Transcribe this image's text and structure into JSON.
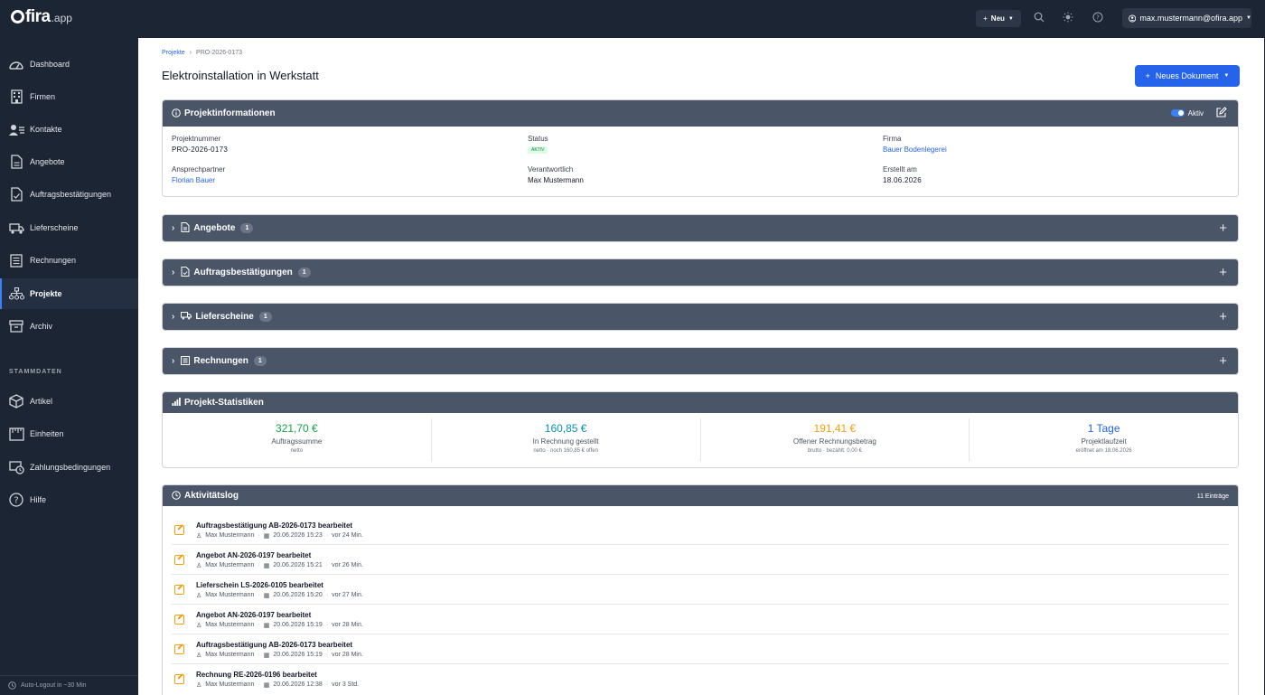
{
  "topbar": {
    "logo_name": "fira",
    "logo_tld": ".app",
    "new_label": "Neu",
    "user_email": "max.mustermann@ofira.app"
  },
  "sidebar": {
    "items": [
      {
        "label": "Dashboard",
        "icon": "dashboard-icon"
      },
      {
        "label": "Firmen",
        "icon": "building-icon"
      },
      {
        "label": "Kontakte",
        "icon": "contacts-icon"
      },
      {
        "label": "Angebote",
        "icon": "document-icon"
      },
      {
        "label": "Auftragsbestätigungen",
        "icon": "document-check-icon"
      },
      {
        "label": "Lieferscheine",
        "icon": "truck-icon"
      },
      {
        "label": "Rechnungen",
        "icon": "invoice-icon"
      },
      {
        "label": "Projekte",
        "icon": "project-tree-icon",
        "active": true
      },
      {
        "label": "Archiv",
        "icon": "archive-icon"
      }
    ],
    "section_title": "STAMMDATEN",
    "master_items": [
      {
        "label": "Artikel",
        "icon": "box-icon"
      },
      {
        "label": "Einheiten",
        "icon": "ruler-icon"
      },
      {
        "label": "Zahlungsbedingungen",
        "icon": "payment-icon"
      },
      {
        "label": "Hilfe",
        "icon": "help-icon"
      }
    ],
    "footer_text": "Auto-Logout in ~30 Min"
  },
  "breadcrumb": {
    "root": "Projekte",
    "current": "PRO-2026-0173"
  },
  "page": {
    "title": "Elektroinstallation in Werkstatt",
    "new_document_label": "Neues Dokument"
  },
  "project_info": {
    "title": "Projektinformationen",
    "active_label": "Aktiv",
    "fields": {
      "number_label": "Projektnummer",
      "number": "PRO-2026-0173",
      "status_label": "Status",
      "status": "AKTIV",
      "company_label": "Firma",
      "company": "Bauer Bodenlegerei",
      "contact_label": "Ansprechpartner",
      "contact": "Florian Bauer",
      "responsible_label": "Verantwortlich",
      "responsible": "Max Mustermann",
      "created_label": "Erstellt am",
      "created": "18.06.2026"
    }
  },
  "sections": [
    {
      "title": "Angebote",
      "count": "1"
    },
    {
      "title": "Auftragsbestätigungen",
      "count": "1"
    },
    {
      "title": "Lieferscheine",
      "count": "1"
    },
    {
      "title": "Rechnungen",
      "count": "1"
    }
  ],
  "stats": {
    "title": "Projekt-Statistiken",
    "items": [
      {
        "value": "321,70 €",
        "label": "Auftragssumme",
        "sub": "netto",
        "color": "#16a34a"
      },
      {
        "value": "160,85 €",
        "label": "In Rechnung gestellt",
        "sub": "netto · noch 160,85 € offen",
        "color": "#0891b2"
      },
      {
        "value": "191,41 €",
        "label": "Offener Rechnungsbetrag",
        "sub": "brutto · bezahlt: 0,00 €",
        "color": "#f59e0b"
      },
      {
        "value": "1 Tage",
        "label": "Projektlaufzeit",
        "sub": "eröffnet am 18.06.2026",
        "color": "#2563eb"
      }
    ]
  },
  "activity": {
    "title": "Aktivitätslog",
    "entries_label": "11 Einträge",
    "rows": [
      {
        "title": "Auftragsbestätigung AB-2026-0173 bearbeitet",
        "user": "Max Mustermann",
        "date": "20.06.2026 15:23",
        "ago": "vor 24 Min."
      },
      {
        "title": "Angebot AN-2026-0197 bearbeitet",
        "user": "Max Mustermann",
        "date": "20.06.2026 15:21",
        "ago": "vor 26 Min."
      },
      {
        "title": "Lieferschein LS-2026-0105 bearbeitet",
        "user": "Max Mustermann",
        "date": "20.06.2026 15:20",
        "ago": "vor 27 Min."
      },
      {
        "title": "Angebot AN-2026-0197 bearbeitet",
        "user": "Max Mustermann",
        "date": "20.06.2026 15:19",
        "ago": "vor 28 Min."
      },
      {
        "title": "Auftragsbestätigung AB-2026-0173 bearbeitet",
        "user": "Max Mustermann",
        "date": "20.06.2026 15:19",
        "ago": "vor 28 Min."
      },
      {
        "title": "Rechnung RE-2026-0196 bearbeitet",
        "user": "Max Mustermann",
        "date": "20.06.2026 12:38",
        "ago": "vor 3 Std."
      }
    ]
  }
}
